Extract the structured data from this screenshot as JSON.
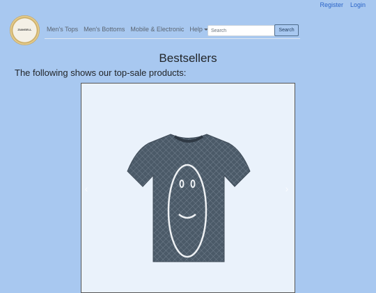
{
  "auth": {
    "register_label": "Register",
    "login_label": "Login"
  },
  "logo": {
    "text": "ZIANSELL"
  },
  "nav": {
    "items": [
      {
        "label": "Men's Tops"
      },
      {
        "label": "Men's Bottoms"
      },
      {
        "label": "Mobile & Electronic"
      },
      {
        "label": "Help"
      }
    ]
  },
  "search": {
    "placeholder": "Search",
    "button_label": "Search"
  },
  "main": {
    "title": "Bestsellers",
    "intro": "The following shows our top-sale products:"
  },
  "carousel": {
    "prev_icon": "chevron-left-icon",
    "next_icon": "chevron-right-icon",
    "slide_image": "smiley-tshirt"
  },
  "colors": {
    "page_background": "#a8c8f0",
    "link": "#2a64c8",
    "shirt": "#4b5a68"
  }
}
